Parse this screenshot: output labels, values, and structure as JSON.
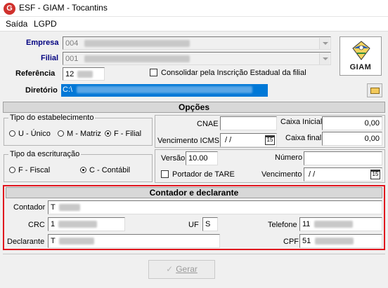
{
  "window": {
    "title": "ESF - GIAM - Tocantins",
    "icon": "app-g-icon"
  },
  "menu": {
    "items": [
      "Saída",
      "LGPD"
    ]
  },
  "header": {
    "empresa_label": "Empresa",
    "empresa_value": "004",
    "filial_label": "Filial",
    "filial_value": "001",
    "referencia_label": "Referência",
    "referencia_value": "12",
    "consolidar_label": "Consolidar pela Inscrição Estadual da filial",
    "diretorio_label": "Diretório",
    "diretorio_value": "C:\\",
    "logo_text": "GIAM",
    "folder_icon": "folder-open-icon"
  },
  "opcoes": {
    "title": "Opções",
    "tipo_estab": {
      "title": "Tipo do estabelecimento",
      "options": [
        "U - Único",
        "M - Matriz",
        "F - Filial"
      ],
      "selected": "F - Filial"
    },
    "tipo_escrit": {
      "title": "Tipo da escrituração",
      "options": [
        "F - Fiscal",
        "C - Contábil"
      ],
      "selected": "C - Contábil"
    },
    "cnae_label": "CNAE",
    "caixa_inicial_label": "Caixa Inicial",
    "caixa_inicial_value": "0,00",
    "venc_icms_label": "Vencimento ICMS",
    "venc_icms_value": "/  /",
    "caixa_final_label": "Caixa final",
    "caixa_final_value": "0,00",
    "versao_label": "Versão",
    "versao_value": "10.00",
    "numero_label": "Número",
    "portador_label": "Portador de TARE",
    "vencimento_label": "Vencimento",
    "vencimento_value": "/  /",
    "calendar_day": "15"
  },
  "contador": {
    "title": "Contador e declarante",
    "contador_label": "Contador",
    "contador_value": "T",
    "crc_label": "CRC",
    "crc_value": "1",
    "uf_label": "UF",
    "uf_value": "S",
    "telefone_label": "Telefone",
    "telefone_value": "11",
    "declarante_label": "Declarante",
    "declarante_value": "T",
    "cpf_label": "CPF",
    "cpf_value": "51"
  },
  "actions": {
    "gerar_label": "Gerar",
    "gerar_icon": "check-icon"
  },
  "colors": {
    "highlight": "#e0141e",
    "selection": "#0078d7",
    "label_blue": "#000080"
  }
}
